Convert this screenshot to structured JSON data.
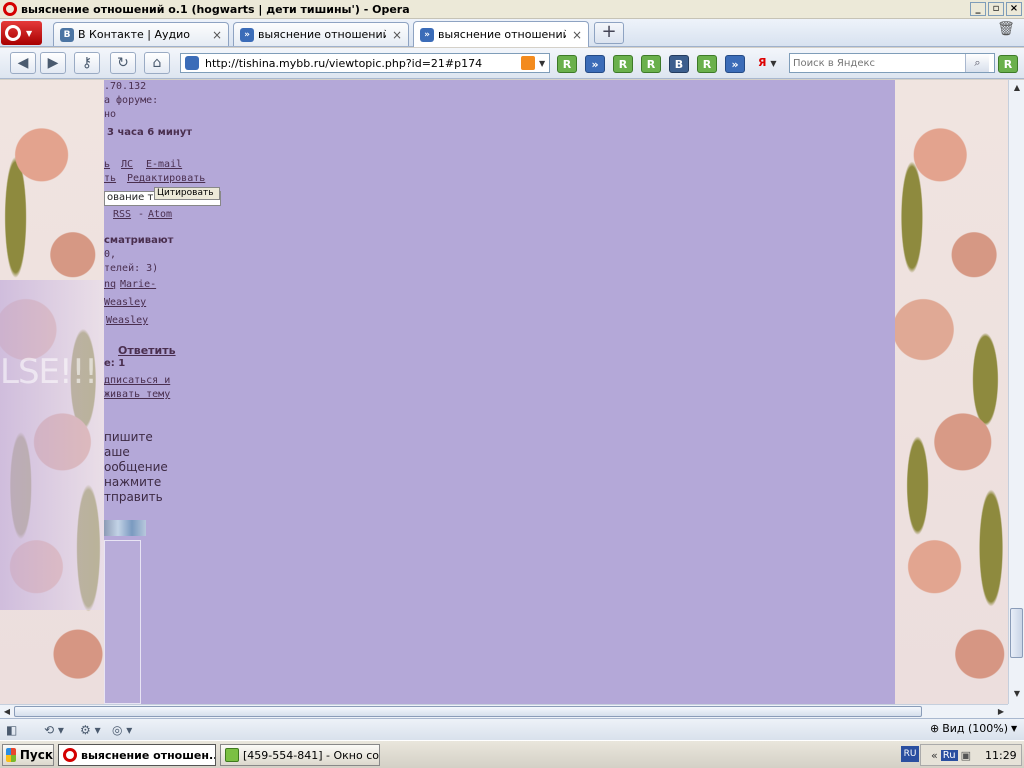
{
  "window": {
    "title": "выяснение отношений о.1 (hogwarts | дети тишины') - Opera"
  },
  "tabs": [
    {
      "label": "В Контакте | Аудио",
      "icon": "vk-icon",
      "active": false
    },
    {
      "label": "выяснение отношений ...",
      "icon": "mybb-icon",
      "active": false
    },
    {
      "label": "выяснение отношений ...",
      "icon": "mybb-icon",
      "active": true
    }
  ],
  "address": {
    "url": "http://tishina.mybb.ru/viewtopic.php?id=21#p174"
  },
  "bookmarks": [
    "R",
    "»",
    "R",
    "R",
    "В",
    "R",
    "»"
  ],
  "search": {
    "engine": "Я",
    "placeholder": "Поиск в Яндекс",
    "extra_button": "R"
  },
  "page": {
    "lines": [
      ".70.132",
      "а форуме:",
      "но",
      "3 часа 6 минут",
      "ь",
      "ЛС",
      "E-mail",
      "ть",
      "Редактировать",
      "ование темы",
      "Цитировать",
      "RSS",
      "-",
      "Atom",
      "сматривают",
      "0,",
      "телей: 3)",
      "nq",
      "Marie-",
      "Weasley",
      "Weasley",
      "Ответить",
      "е: 1",
      "дписаться и",
      "живать тему",
      "пишите",
      "аше",
      "ообщение",
      "нажмите",
      "тправить"
    ],
    "background_word": "LSE!!!"
  },
  "statusbar": {
    "zoom": "Вид (100%)"
  },
  "taskbar": {
    "start": "Пуск",
    "tasks": [
      {
        "label": "выяснение отношен...",
        "active": true
      },
      {
        "label": "[459-554-841] - Окно со...",
        "active": false
      }
    ],
    "lang": "RU",
    "tray_lang": "Ru",
    "clock": "11:29"
  }
}
